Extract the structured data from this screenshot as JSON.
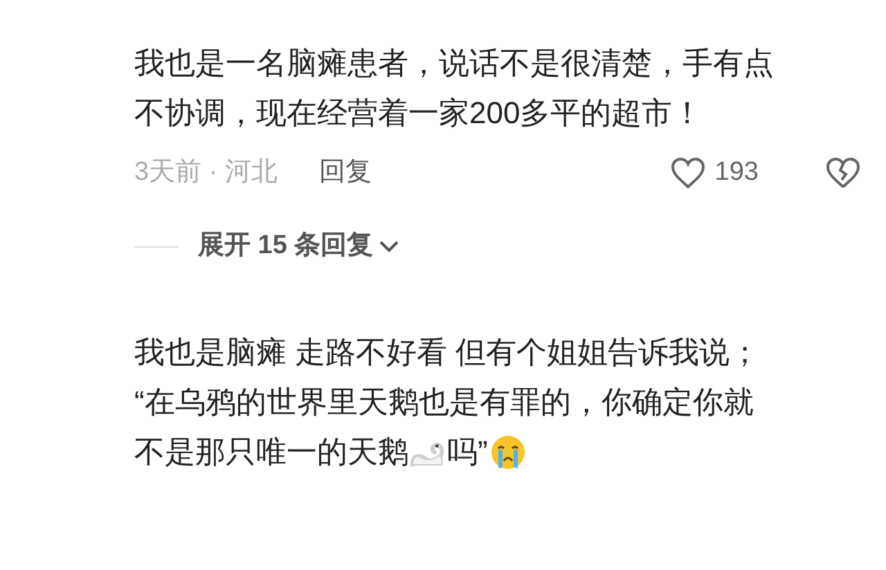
{
  "comments": [
    {
      "lines": [
        [
          {
            "kind": "text",
            "text": "我也是一名脑瘫患者，说话不是很清楚，手有点"
          }
        ],
        [
          {
            "kind": "text",
            "text": "不协调，现在经营着一家200多平的超市！"
          }
        ]
      ],
      "meta": "3天前 · 河北",
      "reply": "回复",
      "likes": "193",
      "liked": false,
      "expand": "展开 15 条回复"
    },
    {
      "lines": [
        [
          {
            "kind": "text",
            "text": "我也是脑瘫 走路不好看 但有个姐姐告诉我说；"
          }
        ],
        [
          {
            "kind": "text",
            "text": "“在乌鸦的世界里天鹅也是有罪的，你确定你就"
          }
        ],
        [
          {
            "kind": "text",
            "text": "不是那只唯一的天鹅"
          },
          {
            "kind": "emoji"
          },
          {
            "kind": "text",
            "text": "吗”"
          },
          {
            "kind": "emoji"
          }
        ]
      ]
    }
  ]
}
